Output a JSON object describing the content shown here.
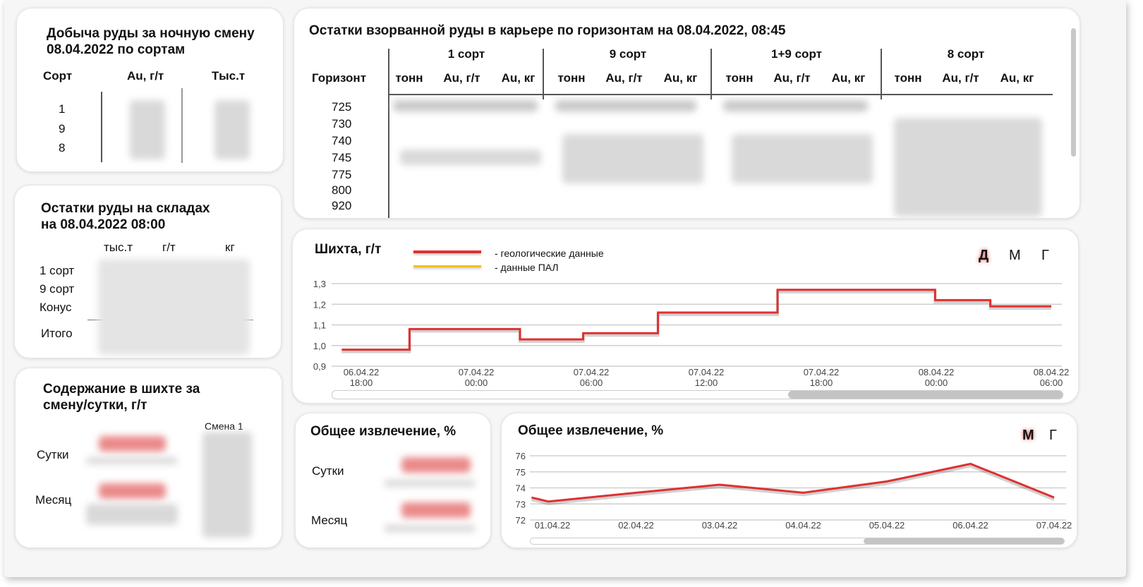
{
  "production": {
    "title_line1": "Добыча руды за ночную смену",
    "title_line2": "08.04.2022 по сортам",
    "col_grade": "Сорт",
    "col_au": "Au, г/т",
    "col_tons": "Тыс.т",
    "rows": [
      "1",
      "9",
      "8"
    ]
  },
  "stock": {
    "title_line1": "Остатки руды на складах",
    "title_line2": "на 08.04.2022 08:00",
    "cols": [
      "тыс.т",
      "г/т",
      "кг"
    ],
    "rows": [
      "1 сорт",
      "9 сорт",
      "Конус"
    ],
    "total": "Итого"
  },
  "blend_content": {
    "title_line1": "Содержание в шихте за",
    "title_line2": "смену/сутки, г/т",
    "shift_label": "Смена 1",
    "rows": [
      "Сутки",
      "Месяц"
    ]
  },
  "remnants": {
    "title": "Остатки взорванной руды в карьере по горизонтам на 08.04.2022, 08:45",
    "horizon_label": "Горизонт",
    "groups": [
      "1 сорт",
      "9 сорт",
      "1+9 сорт",
      "8 сорт"
    ],
    "subcols": [
      "тонн",
      "Au, г/т",
      "Au, кг"
    ],
    "horizons": [
      "725",
      "730",
      "740",
      "745",
      "775",
      "800",
      "920"
    ]
  },
  "blend_chart": {
    "title": "Шихта, г/т",
    "legend": [
      "- геологические данные",
      "- данные ПАЛ"
    ],
    "periods": [
      "Д",
      "М",
      "Г"
    ],
    "active_period": "Д",
    "colors": {
      "geo": "#e03030",
      "pal": "#f2c200"
    }
  },
  "recovery_small": {
    "title": "Общее извлечение, %",
    "rows": [
      "Сутки",
      "Месяц"
    ]
  },
  "recovery_chart": {
    "title": "Общее извлечение, %",
    "periods": [
      "М",
      "Г"
    ],
    "active_period": "М"
  },
  "chart_data": [
    {
      "type": "line",
      "title": "Шихта, г/т",
      "step": true,
      "ylim": [
        0.9,
        1.3
      ],
      "yticks": [
        "1,3",
        "1,2",
        "1,1",
        "1,0",
        "0,9"
      ],
      "xticks": [
        [
          "06.04.22",
          "18:00"
        ],
        [
          "07.04.22",
          "00:00"
        ],
        [
          "07.04.22",
          "06:00"
        ],
        [
          "07.04.22",
          "12:00"
        ],
        [
          "07.04.22",
          "18:00"
        ],
        [
          "08.04.22",
          "00:00"
        ],
        [
          "08.04.22",
          "06:00"
        ]
      ],
      "series": [
        {
          "name": "- геологические данные",
          "x": [
            -0.17,
            0.42,
            1.38,
            1.93,
            2.58,
            3.62,
            4.99,
            5.47,
            6.0
          ],
          "values": [
            0.98,
            1.08,
            1.03,
            1.06,
            1.16,
            1.27,
            1.22,
            1.19,
            1.19
          ]
        }
      ],
      "grid": true
    },
    {
      "type": "line",
      "title": "Общее извлечение, %",
      "ylim": [
        72,
        76
      ],
      "yticks": [
        "76",
        "75",
        "74",
        "73",
        "72"
      ],
      "categories": [
        "01.04.22",
        "02.04.22",
        "03.04.22",
        "04.04.22",
        "05.04.22",
        "06.04.22",
        "07.04.22"
      ],
      "series": [
        {
          "x": [
            -0.25,
            -0.05,
            1,
            2,
            3,
            4,
            5,
            6
          ],
          "values": [
            73.4,
            73.15,
            73.7,
            74.2,
            73.7,
            74.4,
            75.5,
            73.4
          ]
        }
      ],
      "grid": true
    }
  ]
}
